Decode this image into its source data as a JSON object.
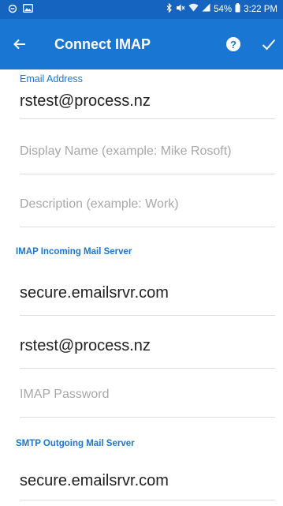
{
  "status_bar": {
    "battery": "54%",
    "time": "3:22 PM"
  },
  "app_bar": {
    "title": "Connect IMAP"
  },
  "form": {
    "email": {
      "label": "Email Address",
      "value": "rstest@process.nz"
    },
    "display_name": {
      "value": "",
      "placeholder": "Display Name (example: Mike Rosoft)"
    },
    "description": {
      "value": "",
      "placeholder": "Description (example: Work)"
    },
    "imap_section": "IMAP Incoming Mail Server",
    "imap_server": {
      "value": "secure.emailsrvr.com"
    },
    "imap_username": {
      "value": "rstest@process.nz"
    },
    "imap_password": {
      "value": "",
      "placeholder": "IMAP Password"
    },
    "smtp_section": "SMTP Outgoing Mail Server",
    "smtp_server": {
      "value": "secure.emailsrvr.com"
    }
  },
  "colors": {
    "status_bar": "#1565c0",
    "app_bar": "#1976d2",
    "accent": "#1976d2",
    "divider": "#dddddd",
    "placeholder": "#a8a8a8"
  }
}
